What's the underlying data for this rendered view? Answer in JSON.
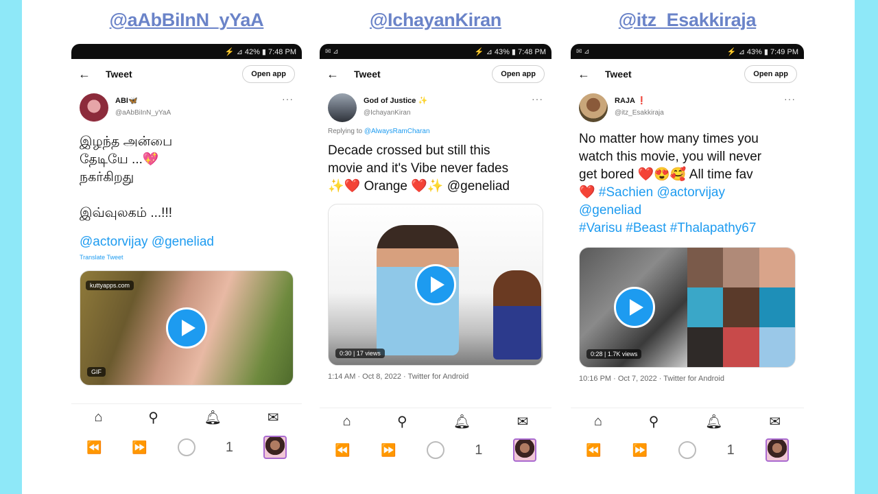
{
  "columns": [
    {
      "handle": "@aAbBiInN_yYaA",
      "status": {
        "left": "",
        "right": "⚡ ⊿ 42% ▮ 7:48 PM"
      },
      "topbar": {
        "back": "←",
        "title": "Tweet",
        "open_app": "Open app"
      },
      "user": {
        "name": "ABI🦋",
        "handle": "@aAbBiInN_yYaA"
      },
      "reply": "",
      "tweet_lines": [
        "இழந்த அன்பை",
        "தேடியே ...💖",
        "நகர்கிறது",
        "",
        "இவ்வுலகம் ...!!!",
        "",
        "@actorvijay @geneliad"
      ],
      "translate": "Translate Tweet",
      "media": {
        "watermark": "kuttyapps.com",
        "badge": "GIF"
      },
      "meta": "",
      "nav_icons": [
        "⌂",
        "⚲",
        "🔔︎",
        "✉"
      ],
      "ctrl": {
        "rewind": "⏪",
        "ff": "⏩",
        "count": "1"
      }
    },
    {
      "handle": "@IchayanKiran",
      "status": {
        "left": "✉ ⊿",
        "right": "⚡ ⊿ 43% ▮ 7:48 PM"
      },
      "topbar": {
        "back": "←",
        "title": "Tweet",
        "open_app": "Open app"
      },
      "user": {
        "name": "God of Justice ✨",
        "handle": "@IchayanKiran"
      },
      "reply": "Replying to",
      "reply_handle": "@AlwaysRamCharan",
      "tweet_lines": [
        "Decade crossed but still this",
        "movie and it's Vibe never fades",
        "✨❤️ Orange ❤️✨ @geneliad"
      ],
      "translate": "",
      "media": {
        "watermark": "",
        "badge": "0:30 | 17 views"
      },
      "meta": "1:14 AM · Oct 8, 2022 · Twitter for Android",
      "nav_icons": [
        "⌂",
        "⚲",
        "🔔︎",
        "✉"
      ],
      "ctrl": {
        "rewind": "⏪",
        "ff": "⏩",
        "count": "1"
      }
    },
    {
      "handle": "@itz_Esakkiraja",
      "status": {
        "left": "✉ ⊿",
        "right": "⚡ ⊿ 43% ▮ 7:49 PM"
      },
      "topbar": {
        "back": "←",
        "title": "Tweet",
        "open_app": "Open app"
      },
      "user": {
        "name": "RAJA ❗",
        "handle": "@itz_Esakkiraja"
      },
      "reply": "",
      "tweet_lines": [
        "No matter how many times you",
        "watch this movie, you will never",
        "get bored ❤️😍🥰 All time fav",
        "❤️ #Sachien @actorvijay",
        "@geneliad",
        "#Varisu #Beast #Thalapathy67"
      ],
      "translate": "",
      "media": {
        "watermark": "",
        "badge": "0:28 | 1.7K views"
      },
      "meta": "10:16 PM · Oct 7, 2022 · Twitter for Android",
      "nav_icons": [
        "⌂",
        "⚲",
        "🔔︎",
        "✉"
      ],
      "ctrl": {
        "rewind": "⏪",
        "ff": "⏩",
        "count": "1"
      }
    }
  ],
  "colors": {
    "accent": "#1d9bf0",
    "handle_title": "#6a83c8",
    "frame": "#8ee8f8"
  }
}
